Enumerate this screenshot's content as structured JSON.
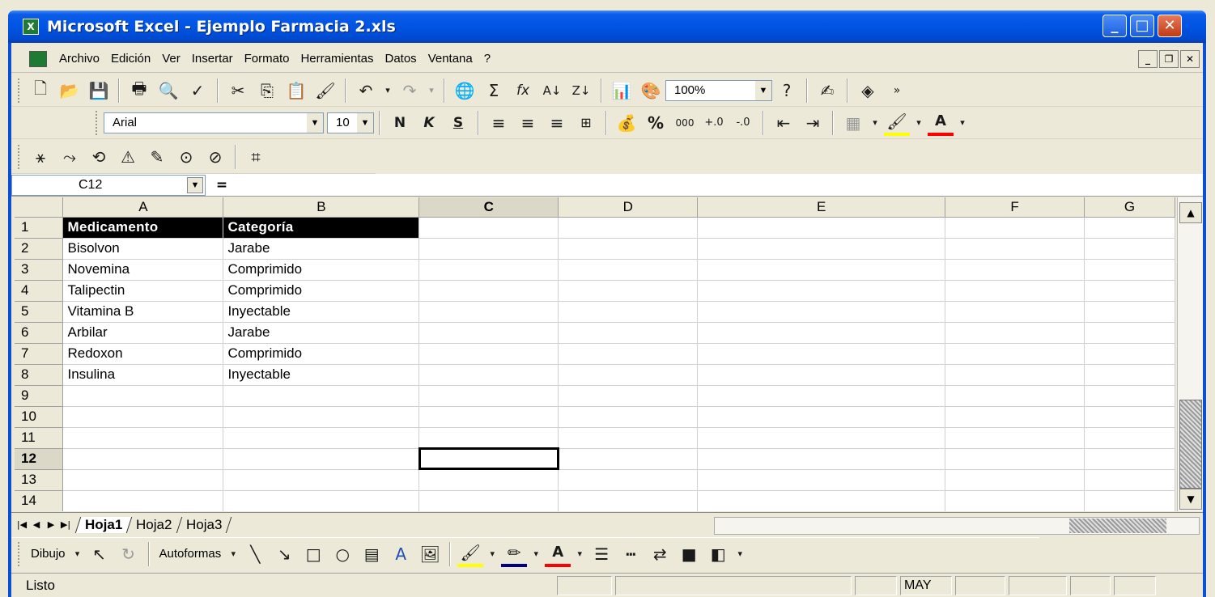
{
  "window": {
    "title": "Microsoft Excel - Ejemplo Farmacia 2.xls",
    "app_icon": "excel-icon",
    "title_bar_color": "#0054e3"
  },
  "menubar": {
    "items": [
      "Archivo",
      "Edición",
      "Ver",
      "Insertar",
      "Formato",
      "Herramientas",
      "Datos",
      "Ventana",
      "?"
    ]
  },
  "toolbar_standard": {
    "zoom": "100%"
  },
  "toolbar_format": {
    "font": "Arial",
    "font_size": "10",
    "bold": "N",
    "italic": "K",
    "underline": "S",
    "percent": "%",
    "thousands": "000",
    "font_color_letter": "A"
  },
  "formula_bar": {
    "cell_ref": "C12",
    "equals": "=",
    "formula": ""
  },
  "sheet": {
    "columns": [
      "A",
      "B",
      "C",
      "D",
      "E",
      "F",
      "G"
    ],
    "row_numbers": [
      "1",
      "2",
      "3",
      "4",
      "5",
      "6",
      "7",
      "8",
      "9",
      "10",
      "11",
      "12",
      "13",
      "14"
    ],
    "header": [
      "Medicamento",
      "Categoría"
    ],
    "rows": [
      [
        "Bisolvon",
        "Jarabe"
      ],
      [
        "Novemina",
        "Comprimido"
      ],
      [
        "Talipectin",
        "Comprimido"
      ],
      [
        "Vitamina B",
        "Inyectable"
      ],
      [
        "Arbilar",
        "Jarabe"
      ],
      [
        "Redoxon",
        "Comprimido"
      ],
      [
        "Insulina",
        "Inyectable"
      ]
    ],
    "active_cell": "C12"
  },
  "sheet_tabs": [
    "Hoja1",
    "Hoja2",
    "Hoja3"
  ],
  "drawing_toolbar": {
    "dibujo": "Dibujo",
    "autoformas": "Autoformas"
  },
  "status_bar": {
    "text": "Listo",
    "caps": "MAY"
  }
}
